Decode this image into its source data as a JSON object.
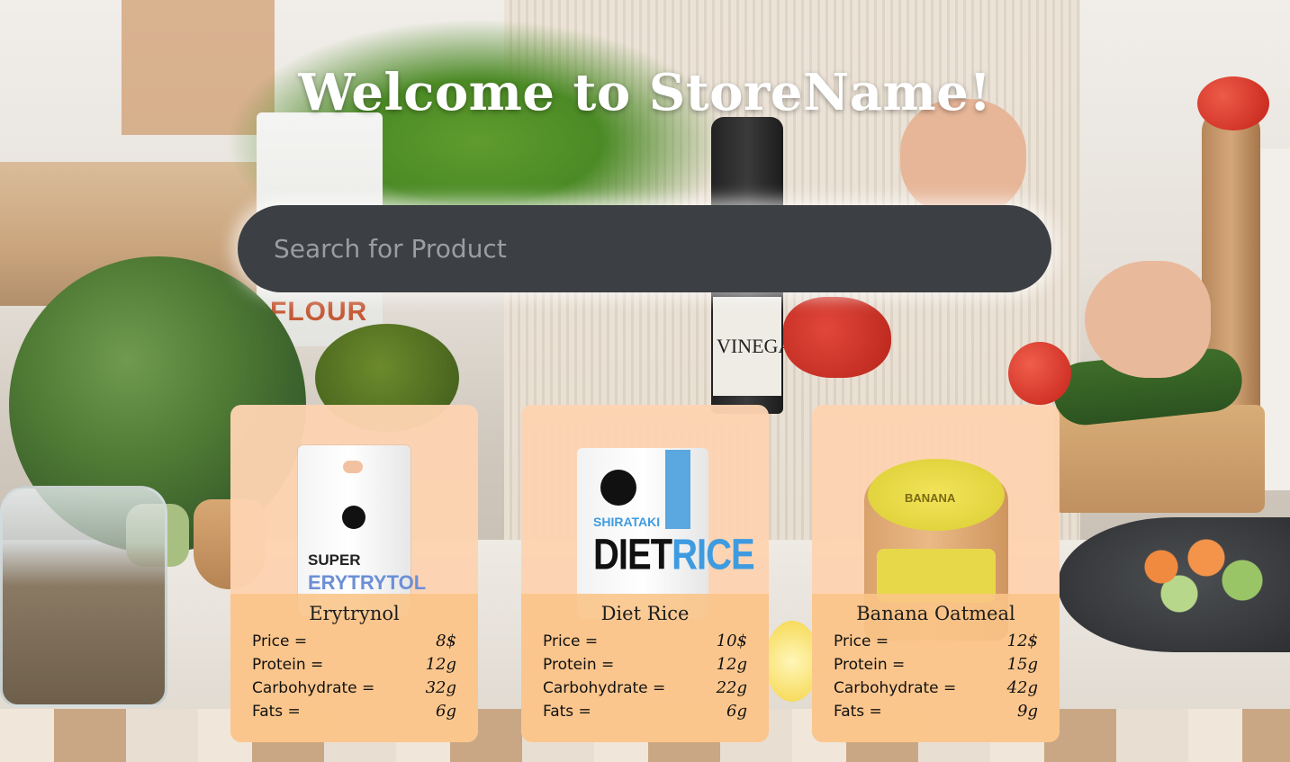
{
  "header": {
    "welcome_text": "Welcome to StoreName!"
  },
  "search": {
    "placeholder": "Search for Product",
    "value": ""
  },
  "background": {
    "flour_label": "FLOUR",
    "vinegar_label": "VINEGAR"
  },
  "labels": {
    "price": "Price =",
    "protein": "Protein =",
    "carbohydrate": "Carbohydrate =",
    "fats": "Fats ="
  },
  "products": [
    {
      "name": "Erytrynol",
      "price": "8$",
      "protein": "12g",
      "carbohydrate": "32g",
      "fats": "6g",
      "package_text": "SUPER",
      "package_text_2": "ERYTRYTOL"
    },
    {
      "name": "Diet Rice",
      "price": "10$",
      "protein": "12g",
      "carbohydrate": "22g",
      "fats": "6g",
      "package_text": "SHIRATAKI",
      "package_text_2": "DIET",
      "package_text_3": "RICE"
    },
    {
      "name": "Banana Oatmeal",
      "price": "12$",
      "protein": "15g",
      "carbohydrate": "42g",
      "fats": "9g",
      "package_text": "BANANA"
    }
  ],
  "colors": {
    "search_bg": "#3c3f43",
    "card_bg": "#fdd3b1",
    "card_info_bg": "#fbc487",
    "welcome_text": "#ffffff"
  }
}
